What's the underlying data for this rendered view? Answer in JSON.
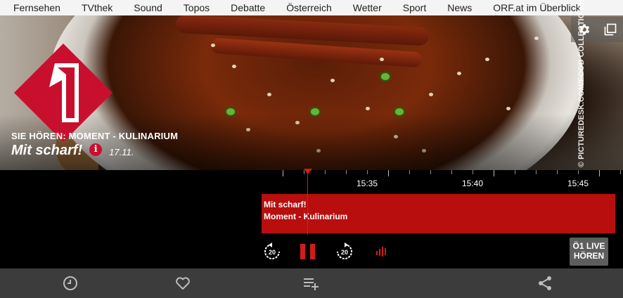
{
  "nav": {
    "items": [
      "Fernsehen",
      "TVthek",
      "Sound",
      "Topos",
      "Debatte",
      "Österreich",
      "Wetter",
      "Sport",
      "News",
      "ORF.at im Überblick"
    ]
  },
  "hero": {
    "kicker": "Sie hören: Moment - Kulinarium",
    "title": "Mit scharf!",
    "info_icon_text": "i",
    "date": "17.11.",
    "credit": "© PICTUREDESK.COM/FOOD COLLECTION/HEIDI VAN TONDER",
    "logo_icon": "oe1-logo-icon",
    "settings_icon": "gear-icon",
    "popout_icon": "popout-window-icon"
  },
  "timeline": {
    "labels": [
      "15:35",
      "15:40",
      "15:45"
    ]
  },
  "program": {
    "title": "Mit scharf!",
    "subtitle": "Moment - Kulinarium"
  },
  "controls": {
    "rewind_label": "20",
    "forward_label": "20",
    "live_line1": "Ö1 LIVE",
    "live_line2": "HÖREN",
    "accent": "#b80e0e"
  },
  "bottombar": {
    "icons": [
      "history-icon",
      "heart-icon",
      "playlist-add-icon",
      "share-icon"
    ]
  }
}
